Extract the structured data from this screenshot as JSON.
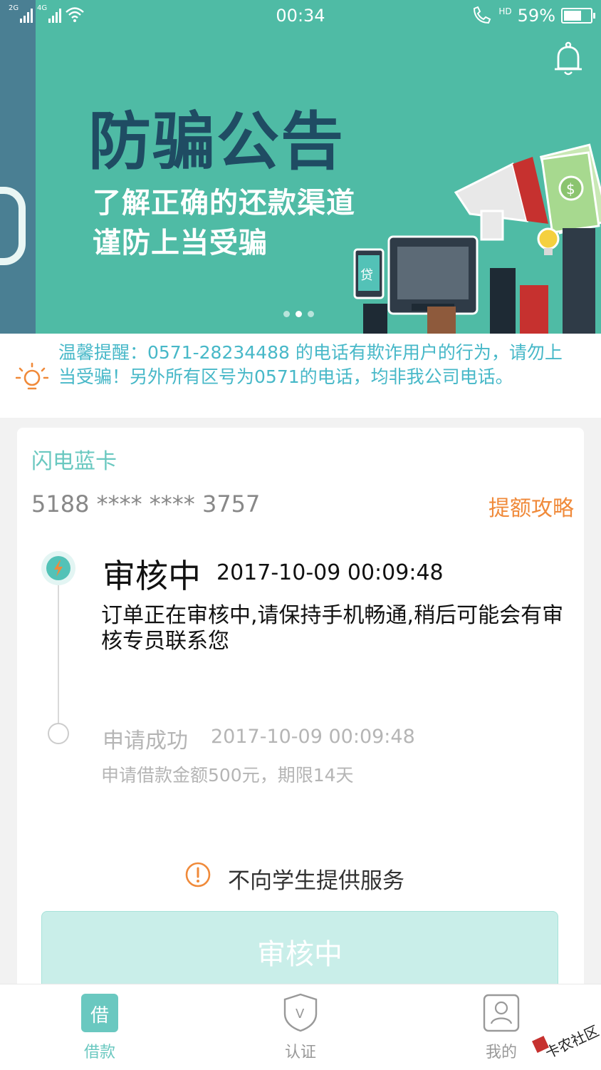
{
  "status_bar": {
    "net1": "2G",
    "net2": "4G",
    "time": "00:34",
    "hd": "HD",
    "battery": "59%"
  },
  "banner": {
    "title": "防骗公告",
    "subtitle_line1": "了解正确的还款渠道",
    "subtitle_line2": "谨防上当受骗",
    "phone_screen_text": "贷",
    "page_count": 3,
    "active_page": 2
  },
  "notice": {
    "text": "温馨提醒：0571-28234488 的电话有欺诈用户的行为，请勿上当受骗！另外所有区号为0571的电话，均非我公司电话。"
  },
  "card": {
    "name": "闪电蓝卡",
    "number": "5188 **** **** 3757",
    "link": "提额攻略"
  },
  "timeline": {
    "current": {
      "title": "审核中",
      "time": "2017-10-09 00:09:48",
      "desc": "订单正在审核中,请保持手机畅通,稍后可能会有审核专员联系您"
    },
    "done": {
      "title": "申请成功",
      "time": "2017-10-09 00:09:48",
      "desc": "申请借款金额500元，期限14天"
    }
  },
  "warning": {
    "text": "不向学生提供服务"
  },
  "action_button": {
    "label": "审核中"
  },
  "bottom_nav": {
    "items": [
      {
        "label": "借款",
        "icon_text": "借",
        "icon": "loan-icon",
        "active": true
      },
      {
        "label": "认证",
        "icon_text": "V",
        "icon": "shield-icon",
        "active": false
      },
      {
        "label": "我的",
        "icon_text": "",
        "icon": "user-icon",
        "active": false
      }
    ]
  },
  "watermark": {
    "text": "卡农社区"
  },
  "colors": {
    "banner_bg": "#4fbba5",
    "teal_accent": "#6ac8c0",
    "orange_accent": "#f08a3a",
    "notice_text": "#47b8c8"
  }
}
